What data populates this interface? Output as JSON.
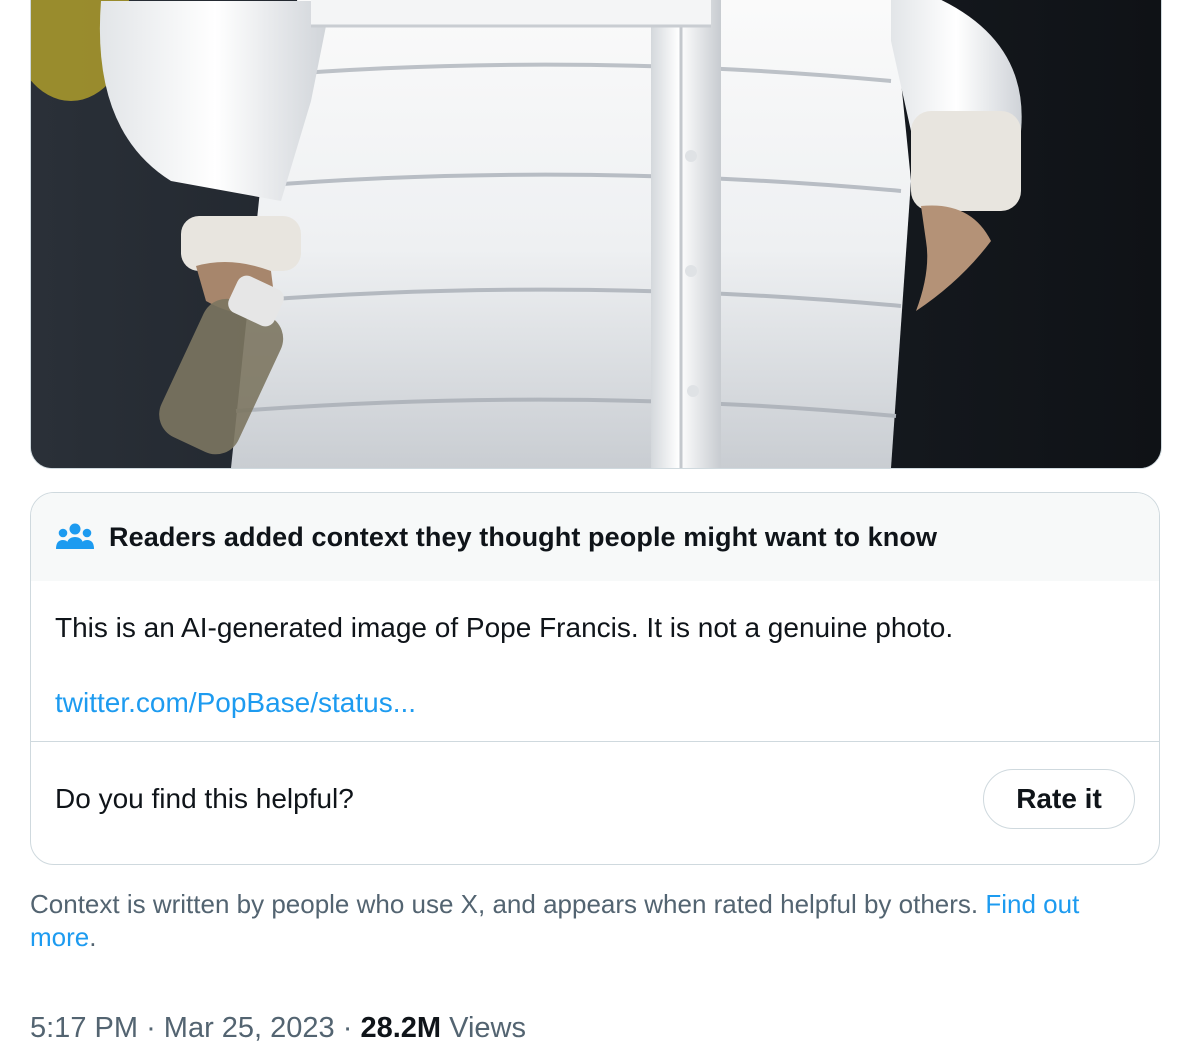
{
  "media": {
    "alt": ""
  },
  "note": {
    "header_title": "Readers added context they thought people might want to know",
    "header_icon": "people-icon",
    "text": "This is an AI-generated image of Pope Francis. It is not a genuine photo.",
    "link_text": "twitter.com/PopBase/status...",
    "helpful_question": "Do you find this helpful?",
    "rate_button_label": "Rate it"
  },
  "disclaimer": {
    "text": "Context is written by people who use X, and appears when rated helpful by others.",
    "link_text_1": "Find out",
    "link_text_2": "more",
    "trailing": "."
  },
  "meta": {
    "time": "5:17 PM",
    "separator": "·",
    "date": "Mar 25, 2023",
    "views_count": "28.2M",
    "views_label": "Views"
  },
  "colors": {
    "link": "#1d9bf0",
    "secondary_text": "#536471",
    "border": "#cfd9de",
    "header_bg": "#f7f9f9"
  }
}
